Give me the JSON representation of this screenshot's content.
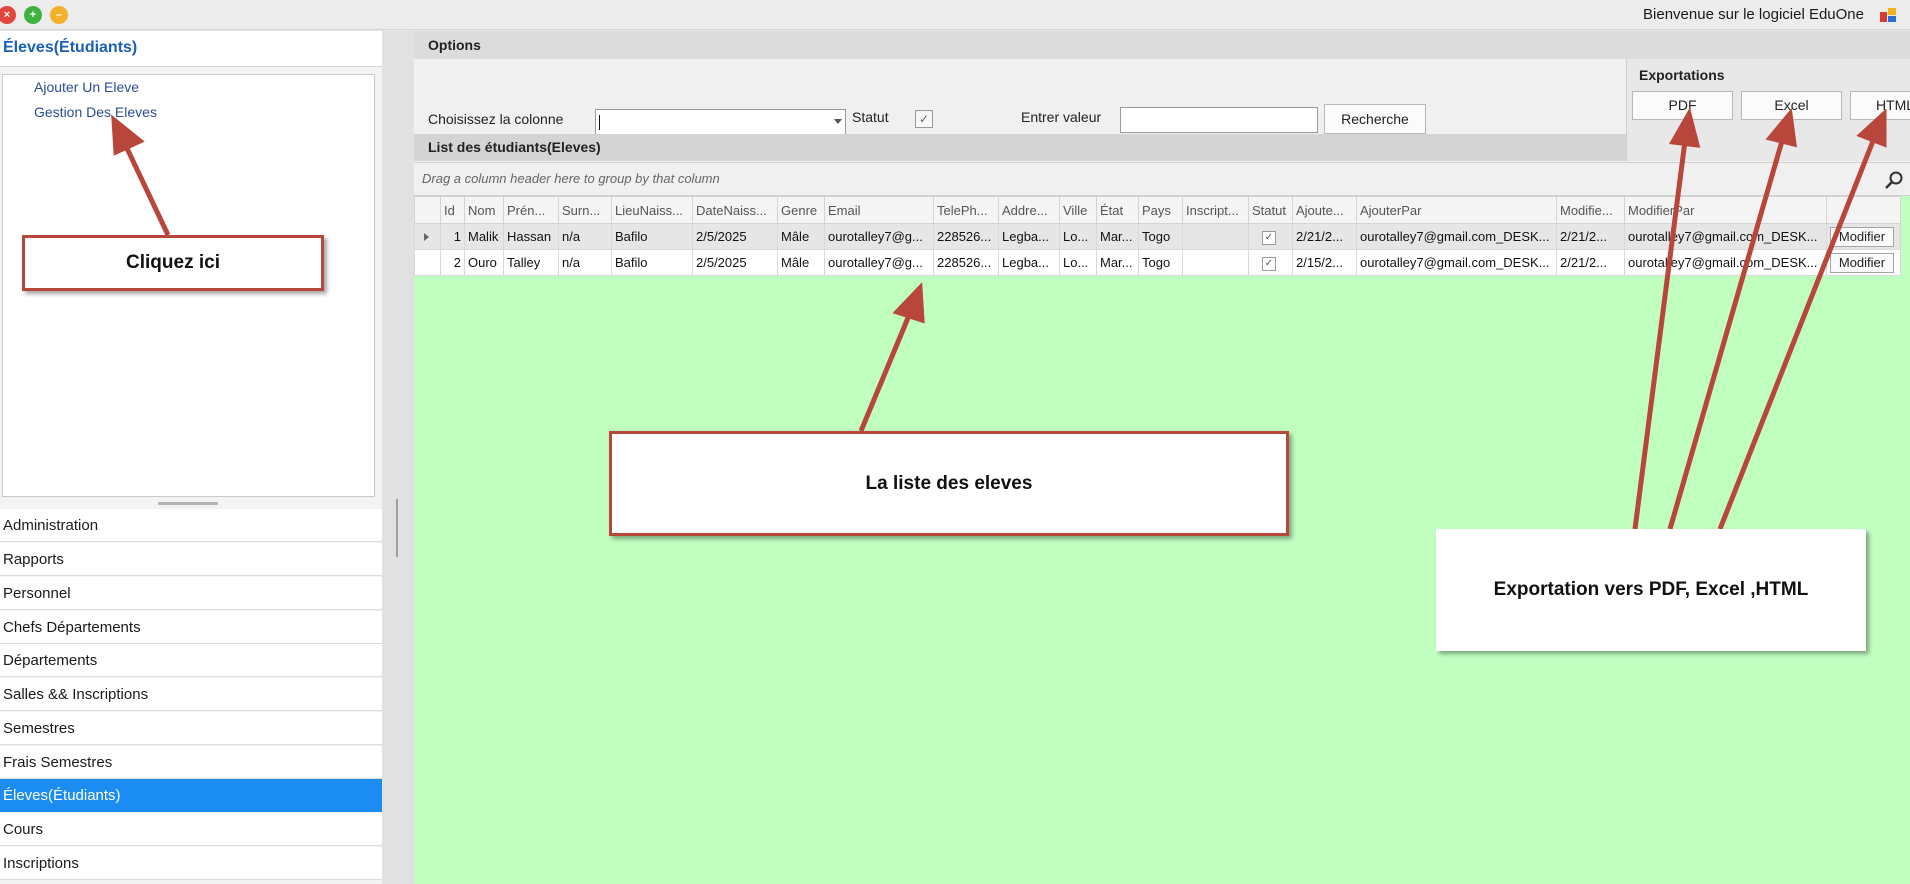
{
  "window": {
    "title": "Bienvenue sur le logiciel EduOne",
    "controls": [
      "close-icon",
      "maximize-icon",
      "minimize-icon"
    ]
  },
  "sidebar": {
    "header": "Éleves(Étudiants)",
    "tree_items": [
      {
        "label": "Ajouter Un Eleve"
      },
      {
        "label": "Gestion Des Eleves"
      }
    ],
    "nav_items": [
      {
        "label": "Administration"
      },
      {
        "label": "Rapports"
      },
      {
        "label": "Personnel"
      },
      {
        "label": "Chefs Départements"
      },
      {
        "label": "Départements"
      },
      {
        "label": "Salles && Inscriptions"
      },
      {
        "label": "Semestres"
      },
      {
        "label": "Frais Semestres"
      },
      {
        "label": "Éleves(Étudiants)",
        "active": true
      },
      {
        "label": "Cours"
      },
      {
        "label": "Inscriptions"
      }
    ]
  },
  "options": {
    "title": "Options",
    "column_label": "Choisissez la colonne",
    "column_value": "",
    "statut_label": "Statut",
    "statut_checked": true,
    "value_label": "Entrer valeur",
    "value_input": "",
    "search_button": "Recherche"
  },
  "exports": {
    "title": "Exportations",
    "pdf": "PDF",
    "excel": "Excel",
    "html": "HTML"
  },
  "list": {
    "title": "List des étudiants(Eleves)",
    "group_hint": "Drag a column header here to group by that column",
    "columns": [
      "Id",
      "Nom",
      "Prén...",
      "Surn...",
      "LieuNaiss...",
      "DateNaiss...",
      "Genre",
      "Email",
      "TelePh...",
      "Addre...",
      "Ville",
      "État",
      "Pays",
      "Inscript...",
      "Statut",
      "Ajoute...",
      "AjouterPar",
      "Modifie...",
      "ModifierPar",
      ""
    ],
    "rows": [
      {
        "id": "1",
        "nom": "Malik",
        "prenom": "Hassan",
        "surnom": "n/a",
        "lieu": "Bafilo",
        "date": "2/5/2025",
        "genre": "Mâle",
        "email": "ourotalley7@g...",
        "tel": "228526...",
        "adresse": "Legba...",
        "ville": "Lo...",
        "etat": "Mar...",
        "pays": "Togo",
        "inscription": "",
        "statut": true,
        "ajoute": "2/21/2...",
        "ajouter_par": "ourotalley7@gmail.com_DESK...",
        "modifie": "2/21/2...",
        "modifier_par": "ourotalley7@gmail.com_DESK...",
        "action": "Modifier",
        "selected": true
      },
      {
        "id": "2",
        "nom": "Ouro",
        "prenom": "Talley",
        "surnom": "n/a",
        "lieu": "Bafilo",
        "date": "2/5/2025",
        "genre": "Mâle",
        "email": "ourotalley7@g...",
        "tel": "228526...",
        "adresse": "Legba...",
        "ville": "Lo...",
        "etat": "Mar...",
        "pays": "Togo",
        "inscription": "",
        "statut": true,
        "ajoute": "2/15/2...",
        "ajouter_par": "ourotalley7@gmail.com_DESK...",
        "modifie": "2/21/2...",
        "modifier_par": "ourotalley7@gmail.com_DESK...",
        "action": "Modifier",
        "selected": false
      }
    ]
  },
  "annotations": {
    "click_here": "Cliquez ici",
    "student_list": "La liste des eleves",
    "export_note": "Exportation vers PDF, Excel ,HTML"
  },
  "colors": {
    "accent": "#1a8cf2",
    "header_text": "#1b5fbd",
    "grid_background": "#c0ffc0",
    "annotation_red": "#b8463a"
  }
}
